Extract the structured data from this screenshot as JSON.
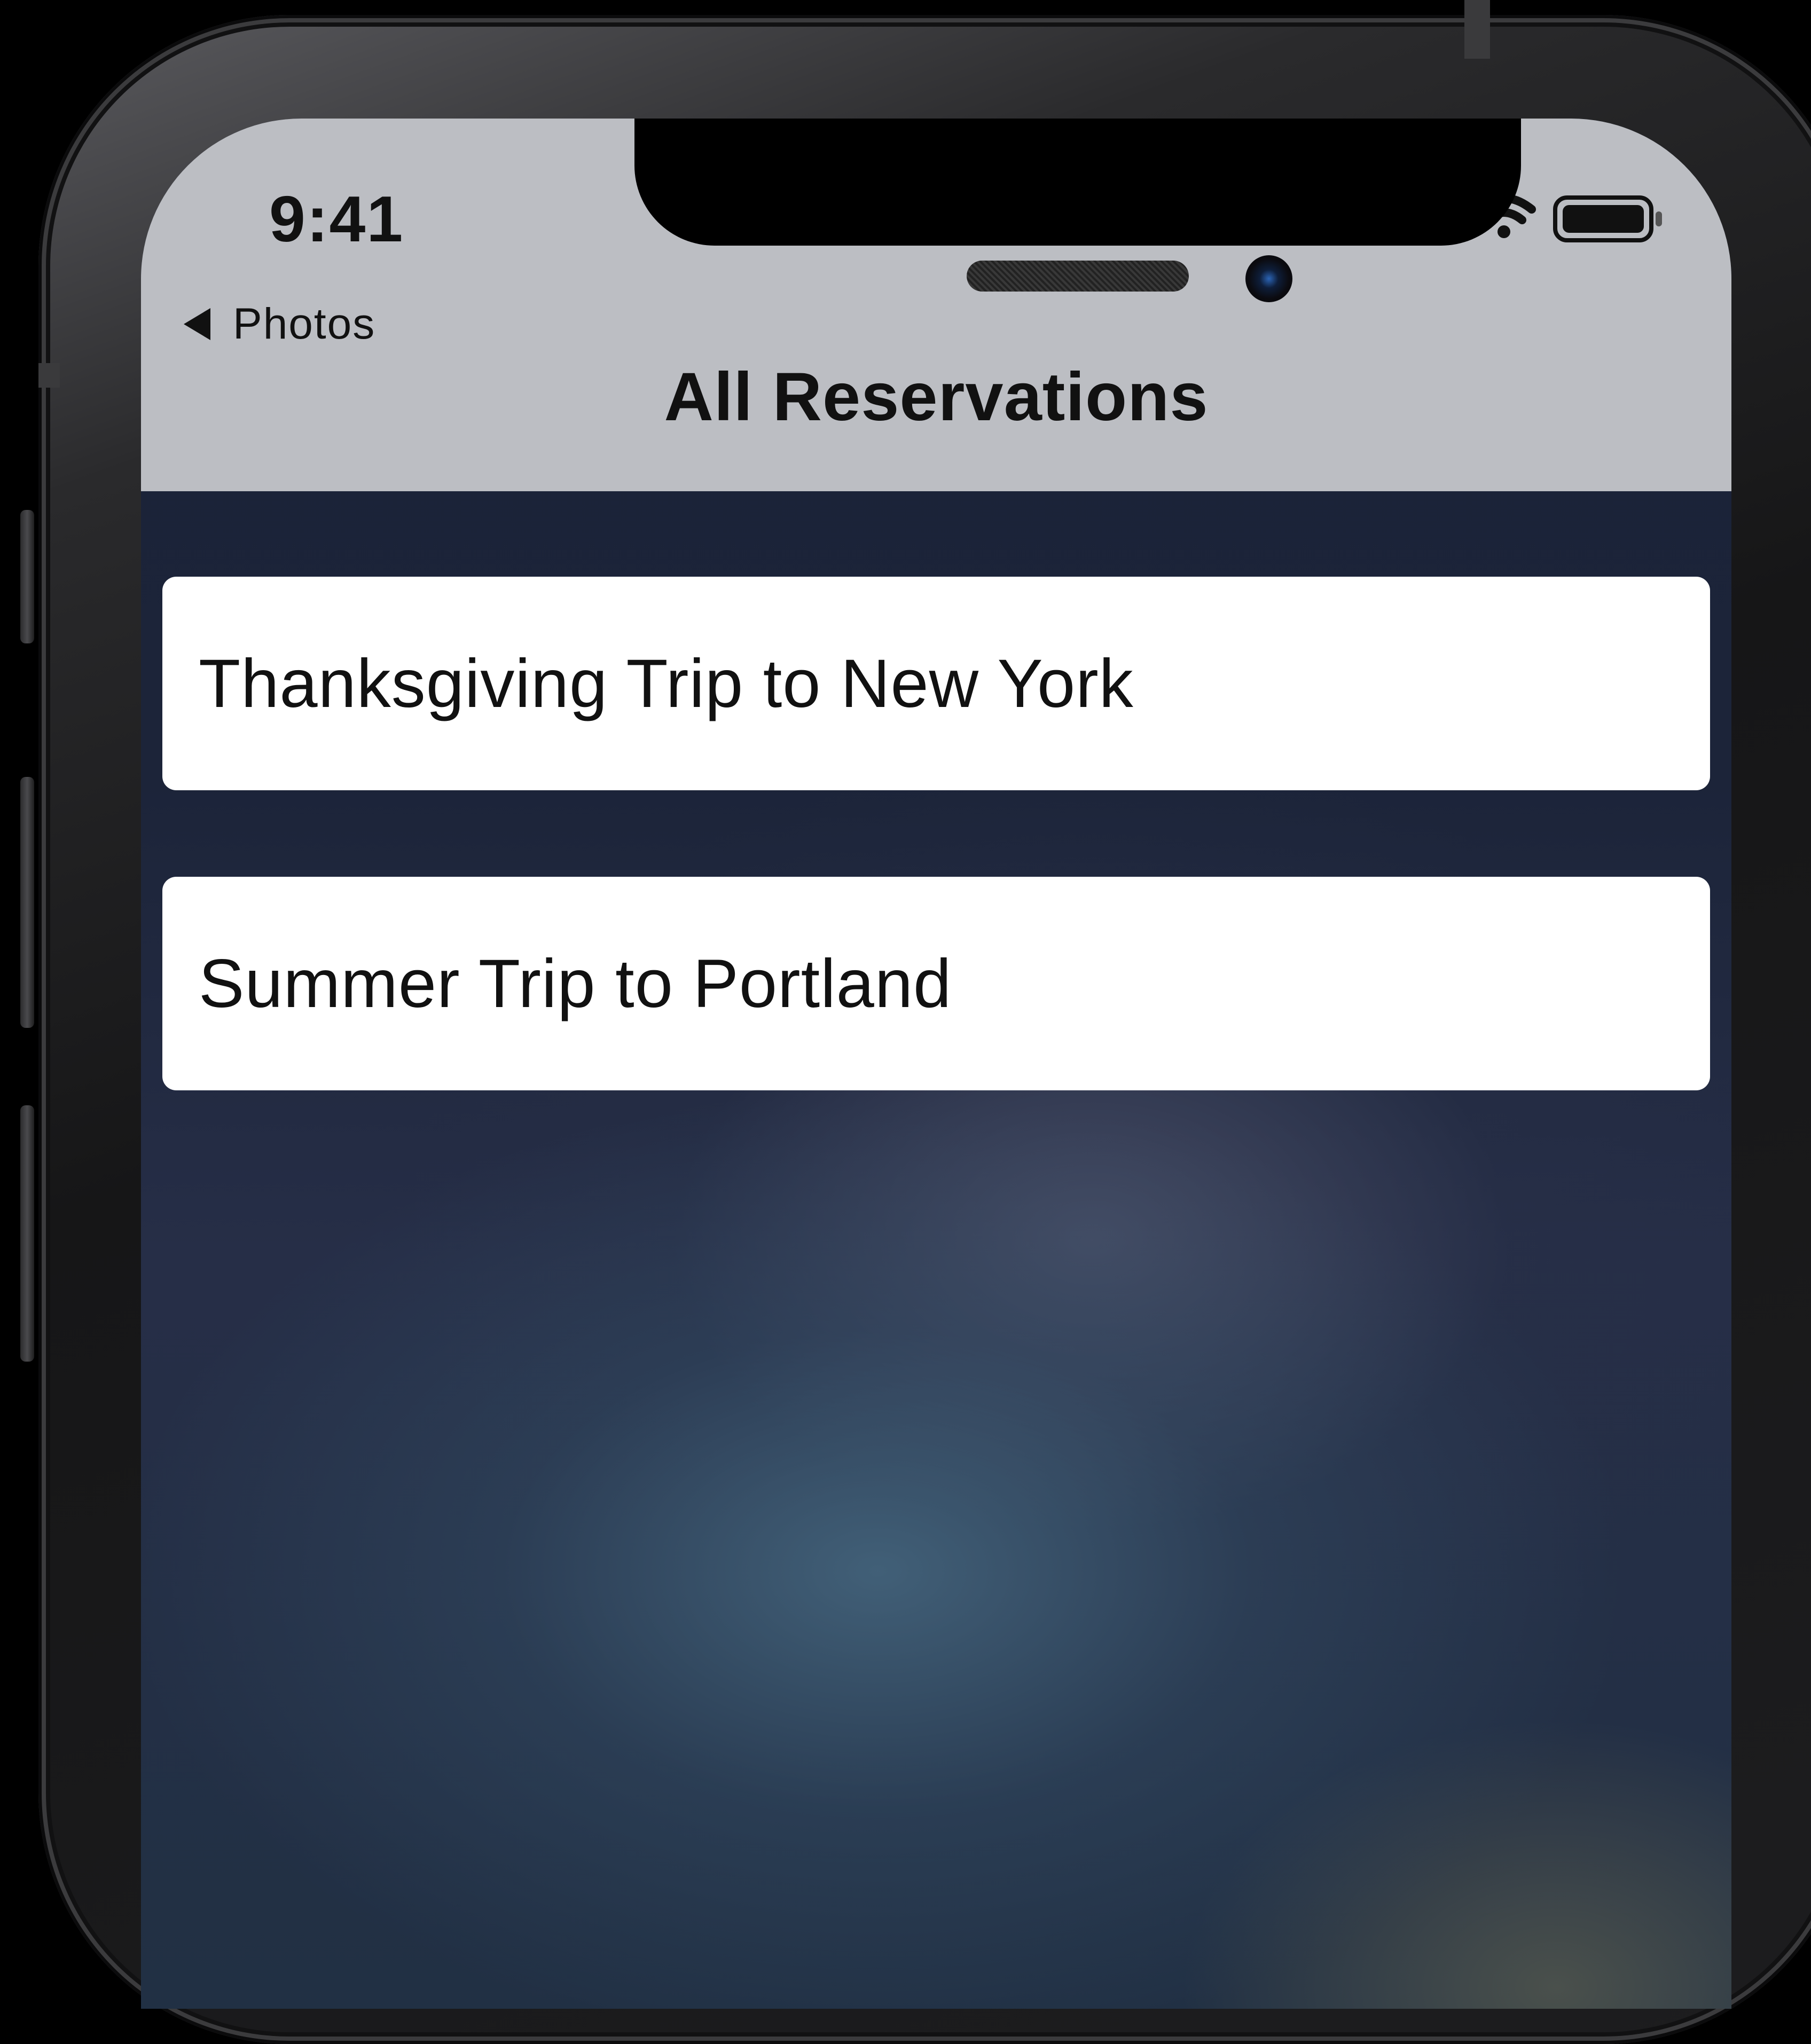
{
  "status_bar": {
    "time": "9:41",
    "icons": [
      "cellular-signal-icon",
      "wifi-icon",
      "battery-icon"
    ]
  },
  "nav": {
    "back_label": "Photos",
    "title": "All Reservations"
  },
  "reservations": [
    {
      "title": "Thanksgiving Trip to New York"
    },
    {
      "title": "Summer Trip to Portland"
    }
  ],
  "colors": {
    "nav_background": "#bcbec3",
    "cell_background": "#ffffff",
    "text": "#111111",
    "screen_background": "#1c2439"
  }
}
